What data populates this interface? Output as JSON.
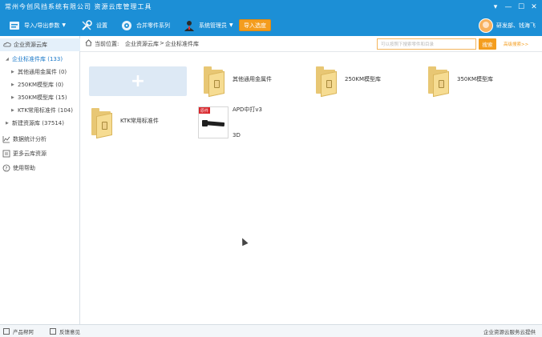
{
  "window": {
    "title": "常州今创风挡系统有限公司 资源云库管理工具",
    "controls": [
      "▾",
      "—",
      "☐",
      "✕"
    ]
  },
  "toolbar": {
    "import_export": "导入/导出参数",
    "settings": "设置",
    "merge_parts": "合并零件系列",
    "system_manage": "系统管理员",
    "import_btn": "导入选度"
  },
  "user": {
    "name": "研发部、钱海飞"
  },
  "sidebar": {
    "root": "企业资源云库",
    "standard_lib": "企业标准件库 (133)",
    "children": [
      "其他通用金属件 (0)",
      "250KM模型库 (0)",
      "350KM模型库 (15)",
      "KTK常用标准件 (104)"
    ],
    "new_lib": "新建资源库 (37514)",
    "stats": "数据统计分析",
    "cloud": "更多云库资源",
    "help": "使用帮助"
  },
  "content": {
    "breadcrumb_label": "当前位置:",
    "crumb1": "企业资源云库",
    "sep": ">",
    "crumb2": "企业标准件库",
    "search_placeholder": "可以按照下搜索零件和目录",
    "search_btn": "搜索",
    "advanced_search": "高级搜索>>",
    "add_symbol": "+",
    "folders": [
      "其他通用金属件",
      "250KM模型库",
      "350KM模型库",
      "KTK常用标准件"
    ],
    "part": {
      "badge": "原件",
      "name": "APD中打v3",
      "type": "3D"
    }
  },
  "statusbar": {
    "left1": "产品帮阿",
    "left2": "反馈意见",
    "right": "企业资源云服务云提供"
  }
}
